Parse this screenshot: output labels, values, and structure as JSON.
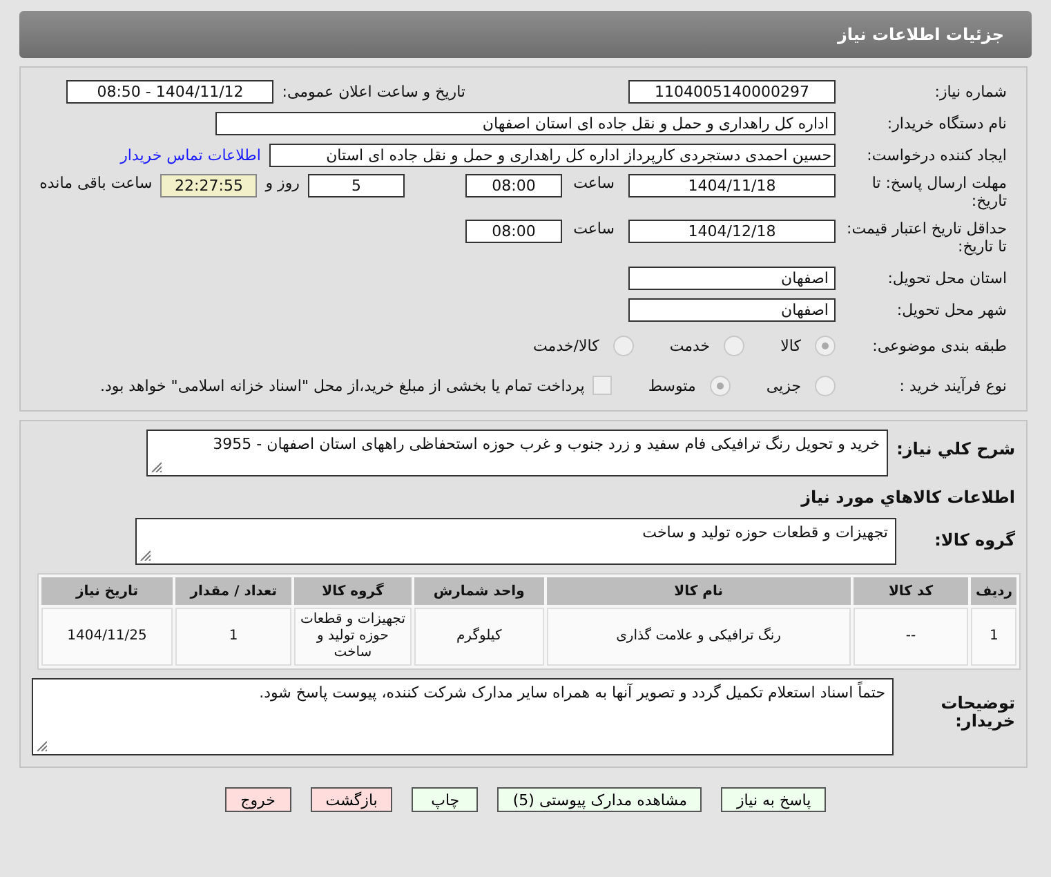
{
  "header": {
    "title": "جزئیات اطلاعات نیاز"
  },
  "fields": {
    "need_number": {
      "label": "شماره نیاز:",
      "value": "1104005140000297"
    },
    "announce": {
      "label": "تاریخ و ساعت اعلان عمومی:",
      "value": "1404/11/12 - 08:50"
    },
    "buyer": {
      "label": "نام دستگاه خریدار:",
      "value": "اداره کل راهداری و حمل و نقل جاده ای استان اصفهان"
    },
    "creator": {
      "label": "ایجاد کننده درخواست:",
      "value": "حسین احمدی دستجردی کارپرداز اداره کل راهداری و حمل و نقل جاده ای استان",
      "link": "اطلاعات تماس خریدار"
    },
    "deadline": {
      "label": "مهلت ارسال پاسخ: تا تاریخ:",
      "date": "1404/11/18",
      "time_label": "ساعت",
      "time": "08:00",
      "days": "5",
      "days_label": "روز و",
      "remaining": "22:27:55",
      "remaining_label": "ساعت باقی مانده"
    },
    "validity": {
      "label": "حداقل تاریخ اعتبار قیمت: تا تاریخ:",
      "date": "1404/12/18",
      "time_label": "ساعت",
      "time": "08:00"
    },
    "province": {
      "label": "استان محل تحویل:",
      "value": "اصفهان"
    },
    "city": {
      "label": "شهر محل تحویل:",
      "value": "اصفهان"
    },
    "category": {
      "label": "طبقه بندی موضوعی:",
      "options": [
        {
          "label": "کالا",
          "selected": true
        },
        {
          "label": "خدمت",
          "selected": false
        },
        {
          "label": "کالا/خدمت",
          "selected": false
        }
      ]
    },
    "process": {
      "label": "نوع فرآیند خرید :",
      "options": [
        {
          "label": "جزیی",
          "selected": false
        },
        {
          "label": "متوسط",
          "selected": true
        }
      ],
      "treasury": {
        "checked": false,
        "label": "پرداخت تمام یا بخشی از مبلغ خرید،از محل \"اسناد خزانه اسلامی\" خواهد بود."
      }
    }
  },
  "description": {
    "label": "شرح کلي نياز:",
    "value": "خرید و تحویل رنگ ترافیکی  فام سفید و زرد جنوب و غرب حوزه استحفاظی راههای استان اصفهان - 3955"
  },
  "goods_heading": "اطلاعات كالاهاي مورد نياز",
  "goods_group": {
    "label": "گروه كالا:",
    "value": "تجهیزات و قطعات حوزه تولید و ساخت"
  },
  "table": {
    "columns": [
      "ردیف",
      "کد کالا",
      "نام کالا",
      "واحد شمارش",
      "گروه کالا",
      "تعداد / مقدار",
      "تاریخ نیاز"
    ],
    "rows": [
      [
        "1",
        "--",
        "رنگ ترافیکی و علامت گذاری",
        "کیلوگرم",
        "تجهیزات و قطعات حوزه تولید و ساخت",
        "1",
        "1404/11/25"
      ]
    ]
  },
  "notes": {
    "label": "توضیحات خریدار:",
    "value": "حتماً اسناد استعلام تکمیل گردد و تصویر آنها به همراه سایر مدارک شرکت کننده، پیوست پاسخ شود."
  },
  "buttons": [
    {
      "label": "پاسخ به نیاز",
      "color": "#eeffee"
    },
    {
      "label": "مشاهده مدارک پیوستی (5)",
      "color": "#eeffee"
    },
    {
      "label": "چاپ",
      "color": "#eeffee"
    },
    {
      "label": "بازگشت",
      "color": "#ffdddd"
    },
    {
      "label": "خروج",
      "color": "#ffdddd"
    }
  ]
}
